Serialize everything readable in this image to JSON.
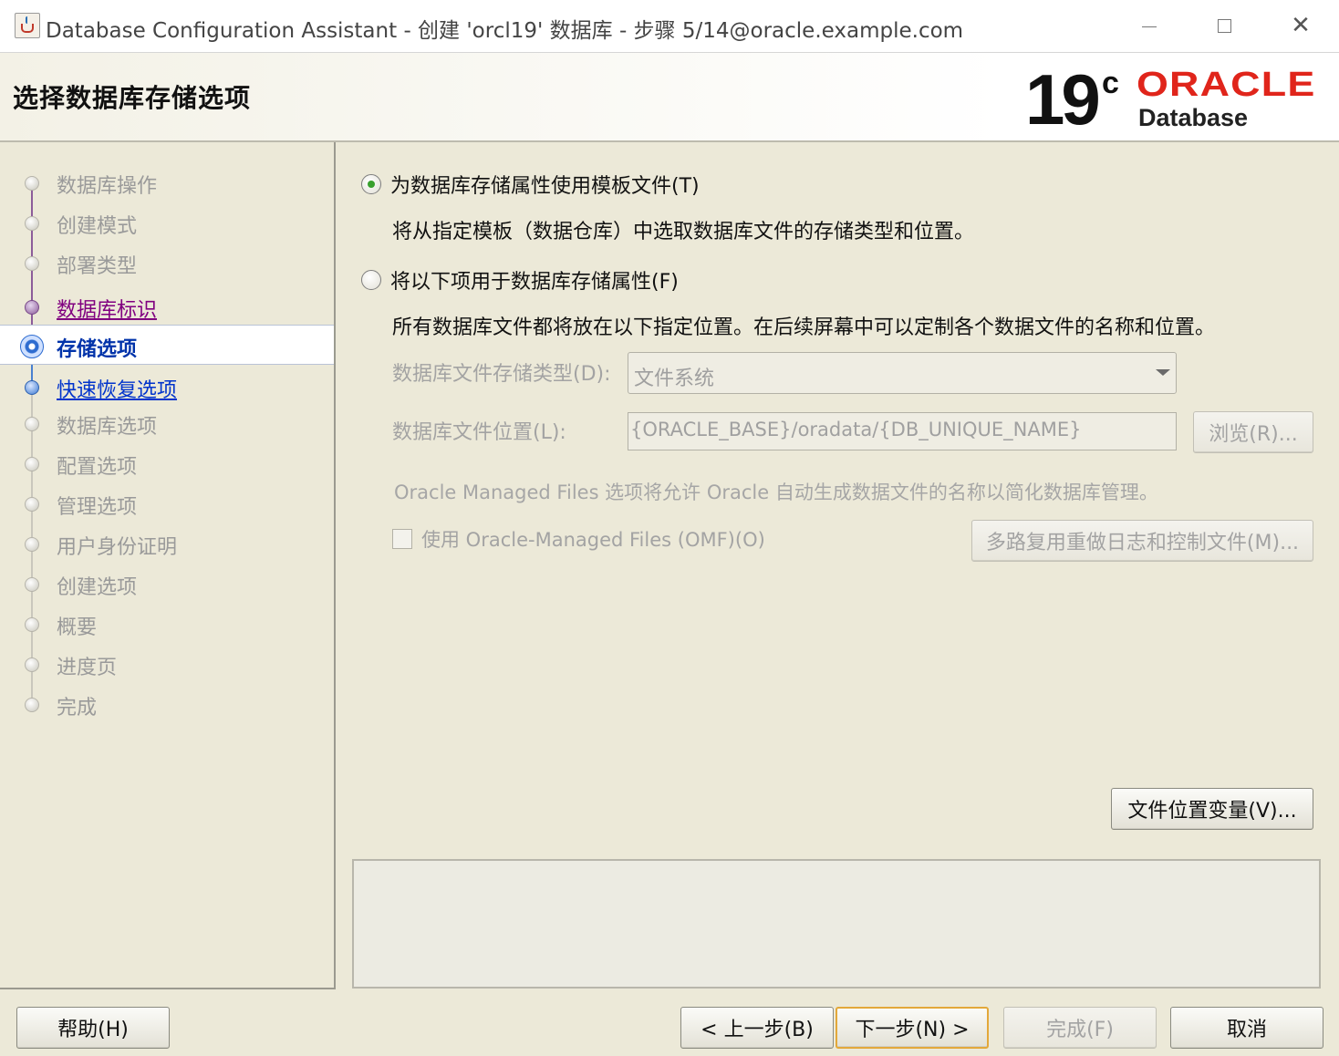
{
  "window": {
    "title": "Database Configuration Assistant - 创建 'orcl19' 数据库 - 步骤 5/14@oracle.example.com",
    "close_glyph": "✕"
  },
  "header": {
    "page_title": "选择数据库存储选项",
    "logo": {
      "version": "19",
      "superscript": "c",
      "brand": "ORACLE",
      "product": "Database"
    }
  },
  "steps": [
    {
      "label": "数据库操作",
      "state": "disabled"
    },
    {
      "label": "创建模式",
      "state": "disabled"
    },
    {
      "label": "部署类型",
      "state": "disabled"
    },
    {
      "label": "数据库标识",
      "state": "done"
    },
    {
      "label": "存储选项",
      "state": "current"
    },
    {
      "label": "快速恢复选项",
      "state": "next"
    },
    {
      "label": "数据库选项",
      "state": "disabled"
    },
    {
      "label": "配置选项",
      "state": "disabled"
    },
    {
      "label": "管理选项",
      "state": "disabled"
    },
    {
      "label": "用户身份证明",
      "state": "disabled"
    },
    {
      "label": "创建选项",
      "state": "disabled"
    },
    {
      "label": "概要",
      "state": "disabled"
    },
    {
      "label": "进度页",
      "state": "disabled"
    },
    {
      "label": "完成",
      "state": "disabled"
    }
  ],
  "storage": {
    "option_template": {
      "label": "为数据库存储属性使用模板文件(T)",
      "description": "将从指定模板（数据仓库）中选取数据库文件的存储类型和位置。",
      "selected": true
    },
    "option_custom": {
      "label": "将以下项用于数据库存储属性(F)",
      "description": "所有数据库文件都将放在以下指定位置。在后续屏幕中可以定制各个数据文件的名称和位置。",
      "selected": false
    },
    "storage_type_label": "数据库文件存储类型(D):",
    "storage_type_value": "文件系统",
    "location_label": "数据库文件位置(L):",
    "location_value": "{ORACLE_BASE}/oradata/{DB_UNIQUE_NAME}",
    "browse_label": "浏览(R)...",
    "omf_note": "Oracle Managed Files 选项将允许 Oracle 自动生成数据文件的名称以简化数据库管理。",
    "omf_checkbox_label": "使用 Oracle-Managed Files (OMF)(O)",
    "omf_checked": false,
    "multiplex_label": "多路复用重做日志和控制文件(M)...",
    "file_location_vars_label": "文件位置变量(V)..."
  },
  "footer": {
    "help": "帮助(H)",
    "back": "< 上一步(B)",
    "next": "下一步(N) >",
    "finish": "完成(F)",
    "cancel": "取消"
  }
}
